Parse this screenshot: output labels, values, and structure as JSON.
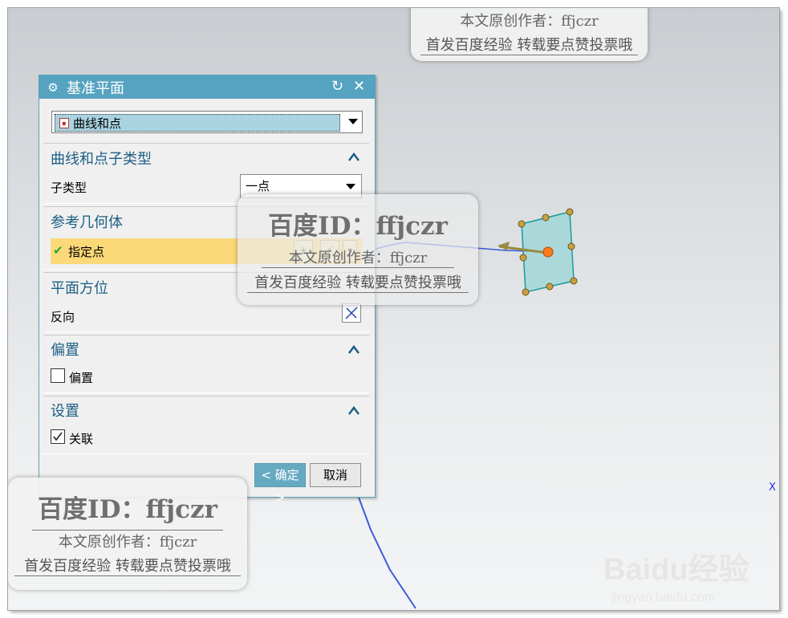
{
  "dialog": {
    "title": "基准平面",
    "type_value": "曲线和点",
    "sections": {
      "subtype": {
        "header": "曲线和点子类型",
        "row_label": "子类型",
        "dropdown_value": "一点"
      },
      "reference": {
        "header": "参考几何体",
        "row_label": "指定点"
      },
      "orientation": {
        "header": "平面方位",
        "row_label": "反向"
      },
      "offset": {
        "header": "偏置",
        "checkbox_label": "偏置",
        "checked": false
      },
      "settings": {
        "header": "设置",
        "checkbox_label": "关联",
        "checked": true
      }
    },
    "ok_label": "< 确定 >",
    "cancel_label": "取消"
  },
  "watermarks": {
    "id_text": "百度ID：ffjczr",
    "author_line": "本文原创作者：ffjczr",
    "promo_line": "首发百度经验 转载要点赞投票哦"
  },
  "viewport": {
    "axis_label": "X"
  },
  "branding": {
    "logo": "Baidu经验",
    "url": "jingyan.baidu.com"
  },
  "colors": {
    "titlebar": "#55a3c0",
    "section_header": "#1c5f86",
    "highlight": "#fbd978",
    "curve": "#3b5bdb",
    "plane": "#7fd1d1"
  }
}
